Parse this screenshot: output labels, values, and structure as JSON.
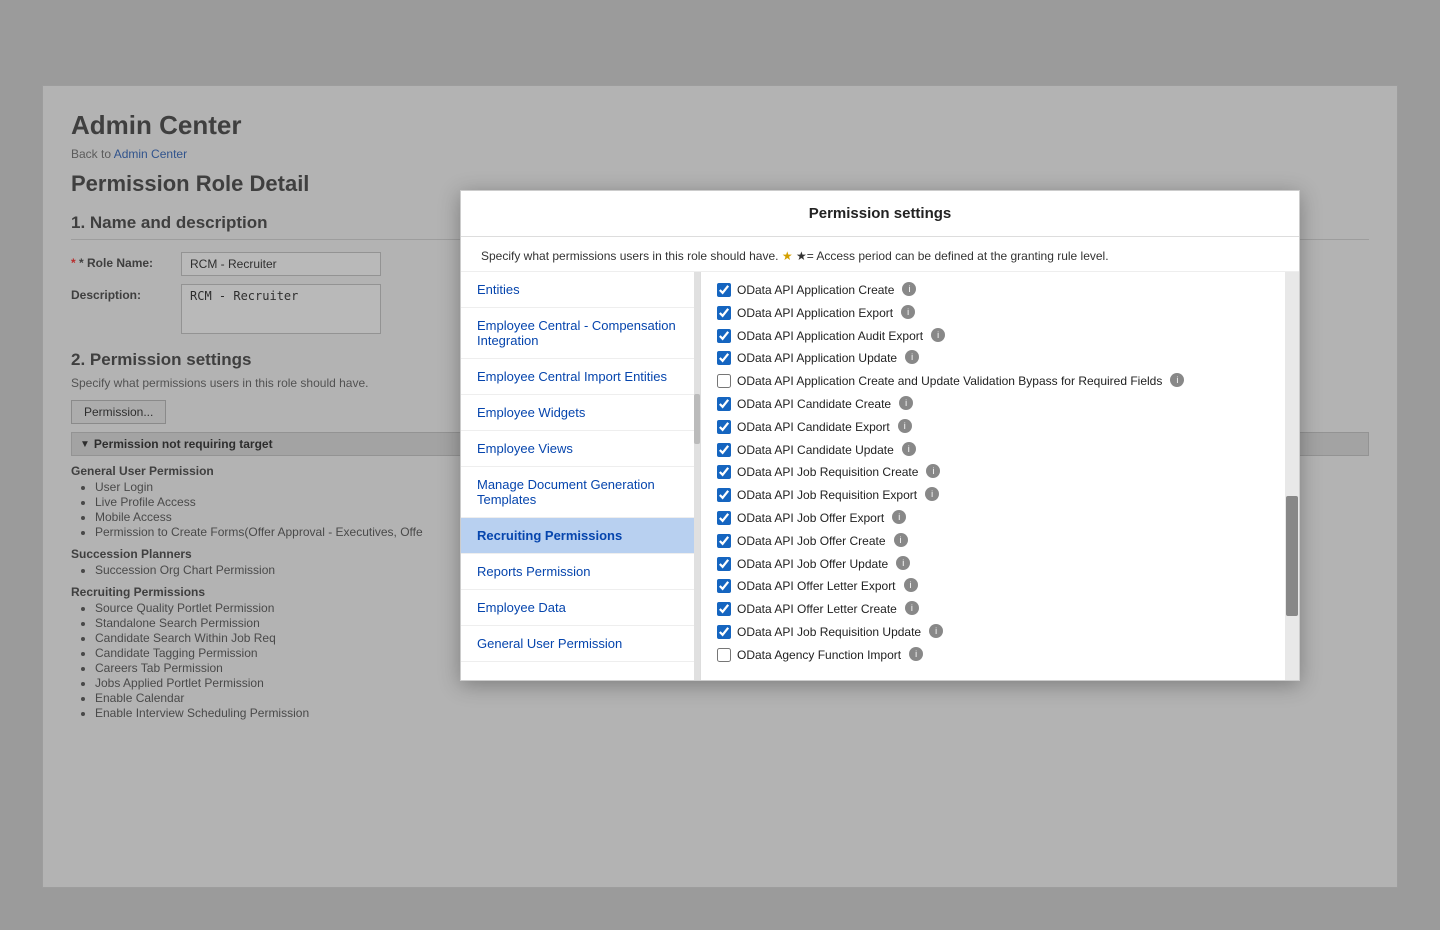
{
  "page": {
    "title": "Admin Center",
    "breadcrumb_text": "Back to",
    "breadcrumb_link": "Admin Center",
    "subtitle": "Permission Role Detail"
  },
  "form": {
    "section1_title": "1. Name and description",
    "role_name_label": "* Role Name:",
    "role_name_value": "RCM - Recruiter",
    "description_label": "Description:",
    "description_value": "RCM - Recruiter",
    "section2_title": "2. Permission settings",
    "section2_subtitle": "Specify what permissions users in this role should have.",
    "permission_btn": "Permission...",
    "perm_not_req_label": "Permission not requiring target"
  },
  "left_pane": {
    "categories": [
      {
        "name": "General User Permission",
        "items": [
          "User Login",
          "Live Profile Access",
          "Mobile Access",
          "Permission to Create Forms(Offer Approval - Executives, Offe"
        ]
      },
      {
        "name": "Succession Planners",
        "items": [
          "Succession Org Chart Permission"
        ]
      },
      {
        "name": "Recruiting Permissions",
        "items": [
          "Source Quality Portlet Permission",
          "Standalone Search Permission",
          "Candidate Search Within Job Req",
          "Candidate Tagging Permission",
          "Careers Tab Permission",
          "Jobs Applied Portlet Permission",
          "Enable Calendar",
          "Enable Interview Scheduling Permission"
        ]
      }
    ]
  },
  "modal": {
    "title": "Permission settings",
    "intro": "Specify what permissions users in this role should have.",
    "intro_star": "★= Access period can be defined at the granting rule level.",
    "left_nav": [
      {
        "label": "Entities",
        "active": false
      },
      {
        "label": "Employee Central - Compensation Integration",
        "active": false
      },
      {
        "label": "Employee Central Import Entities",
        "active": false
      },
      {
        "label": "Employee Widgets",
        "active": false
      },
      {
        "label": "Employee Views",
        "active": false
      },
      {
        "label": "Manage Document Generation Templates",
        "active": false
      },
      {
        "label": "Recruiting Permissions",
        "active": true
      },
      {
        "label": "Reports Permission",
        "active": false
      },
      {
        "label": "Employee Data",
        "active": false
      },
      {
        "label": "General User Permission",
        "active": false
      }
    ],
    "permissions": [
      {
        "label": "OData API Application Create",
        "checked": true,
        "partial": true
      },
      {
        "label": "OData API Application Export",
        "checked": true
      },
      {
        "label": "OData API Application Audit Export",
        "checked": true
      },
      {
        "label": "OData API Application Update",
        "checked": true
      },
      {
        "label": "OData API Application Create and Update Validation Bypass for Required Fields",
        "checked": false
      },
      {
        "label": "OData API Candidate Create",
        "checked": true
      },
      {
        "label": "OData API Candidate Export",
        "checked": true
      },
      {
        "label": "OData API Candidate Update",
        "checked": true
      },
      {
        "label": "OData API Job Requisition Create",
        "checked": true
      },
      {
        "label": "OData API Job Requisition Export",
        "checked": true
      },
      {
        "label": "OData API Job Offer Export",
        "checked": true
      },
      {
        "label": "OData API Job Offer Create",
        "checked": true
      },
      {
        "label": "OData API Job Offer Update",
        "checked": true
      },
      {
        "label": "OData API Offer Letter Export",
        "checked": true
      },
      {
        "label": "OData API Offer Letter Create",
        "checked": true
      },
      {
        "label": "OData API Job Requisition Update",
        "checked": true
      },
      {
        "label": "OData Agency Function Import",
        "checked": false
      }
    ]
  }
}
